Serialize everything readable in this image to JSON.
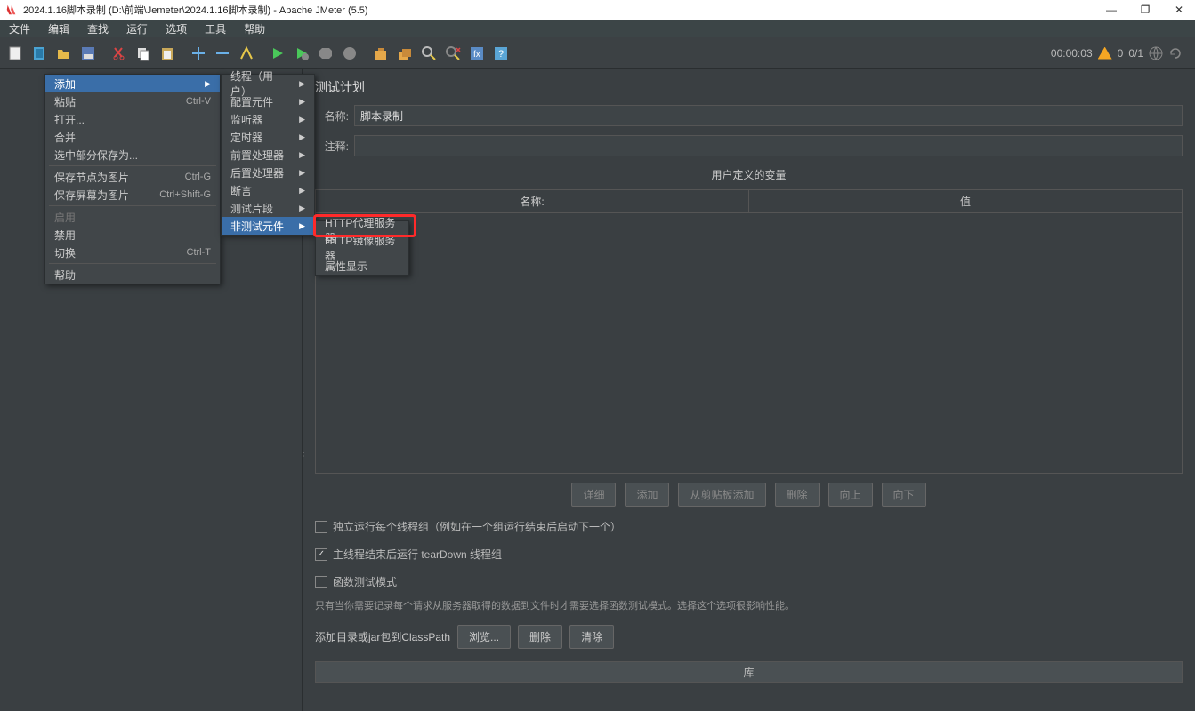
{
  "window": {
    "title": "2024.1.16脚本录制 (D:\\前端\\Jemeter\\2024.1.16脚本录制) - Apache JMeter (5.5)"
  },
  "menubar": {
    "items": [
      "文件",
      "编辑",
      "查找",
      "运行",
      "选项",
      "工具",
      "帮助"
    ]
  },
  "status": {
    "elapsed": "00:00:03",
    "threads": "0",
    "total": "0/1"
  },
  "testPlan": {
    "panelTitle": "测试计划",
    "nameLabel": "名称:",
    "nameValue": "脚本录制",
    "commentLabel": "注释:",
    "commentValue": "",
    "userVarsTitle": "用户定义的变量",
    "colName": "名称:",
    "colValue": "值"
  },
  "buttons": {
    "detail": "详细",
    "add": "添加",
    "addFromClipboard": "从剪贴板添加",
    "delete": "删除",
    "up": "向上",
    "down": "向下",
    "browse": "浏览...",
    "delete2": "删除",
    "clear": "清除"
  },
  "checks": {
    "serial": "独立运行每个线程组（例如在一个组运行结束后启动下一个）",
    "teardown": "主线程结束后运行 tearDown 线程组",
    "functional": "函数测试模式"
  },
  "hint": "只有当你需要记录每个请求从服务器取得的数据到文件时才需要选择函数测试模式。选择这个选项很影响性能。",
  "classpathLabel": "添加目录或jar包到ClassPath",
  "libraryLabel": "库",
  "ctx1": {
    "add": "添加",
    "paste": "粘贴",
    "pasteSc": "Ctrl-V",
    "open": "打开...",
    "merge": "合并",
    "saveSelAs": "选中部分保存为...",
    "saveNodeImg": "保存节点为图片",
    "saveNodeImgSc": "Ctrl-G",
    "saveScreenImg": "保存屏幕为图片",
    "saveScreenImgSc": "Ctrl+Shift-G",
    "enable": "启用",
    "disable": "禁用",
    "toggle": "切换",
    "toggleSc": "Ctrl-T",
    "help": "帮助"
  },
  "ctx2": {
    "threads": "线程（用户）",
    "config": "配置元件",
    "listener": "监听器",
    "timer": "定时器",
    "preproc": "前置处理器",
    "postproc": "后置处理器",
    "assert": "断言",
    "testfrag": "测试片段",
    "nontest": "非测试元件"
  },
  "ctx3": {
    "httpProxy": "HTTP代理服务器",
    "mirror": "HTTP镜像服务器",
    "propDisp": "属性显示"
  }
}
